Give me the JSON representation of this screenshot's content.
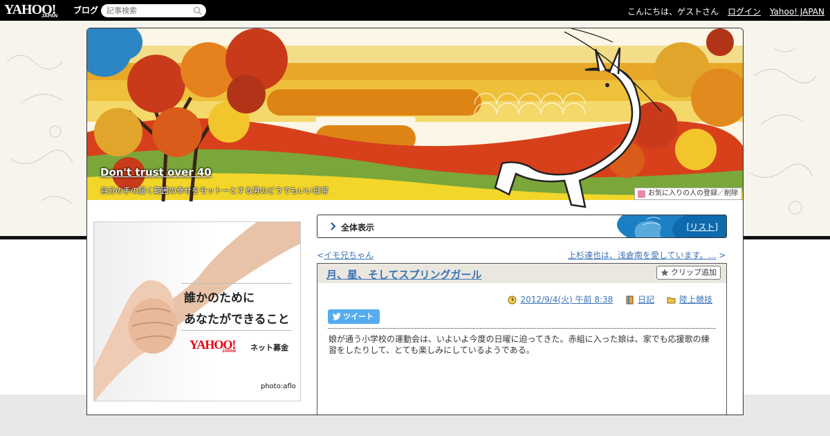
{
  "topbar": {
    "logo_text": "YAHOO!",
    "logo_sub": "JAPAN",
    "logo_service": "ブログ",
    "search_placeholder": "記事検索",
    "greeting": "こんにちは、ゲストさん",
    "login_label": "ログイン",
    "yahoo_japan_label": "Yahoo! JAPAN"
  },
  "header": {
    "blog_title": "Don't trust over 40",
    "blog_description": "自分の手の届く範囲の幸せをモットーとする男のどうでもいい日常",
    "favorite_button": "お気に入りの人の登録／削除"
  },
  "ad": {
    "line1": "誰かのために",
    "line2": "あなたができること",
    "logo_text": "YAHOO!",
    "logo_sub": "JAPAN",
    "service": "ネット募金",
    "credit": "photo:aflo"
  },
  "toolbar": {
    "all_view_label": "全体表示",
    "list_label": "リスト",
    "bracket_open": "[",
    "bracket_close": "]"
  },
  "navigation": {
    "prev_label": "イモ兄ちゃん",
    "prev_arrow": "<",
    "next_label": "上杉達也は、浅倉南を愛しています。…",
    "next_arrow": ">"
  },
  "article": {
    "title": "月、星、そしてスプリングガール",
    "clip_button": "クリップ追加",
    "date": "2012/9/4(火) 午前 8:38",
    "category_diary": "日記",
    "category_folder": "陸上競技",
    "tweet_label": "ツイート",
    "body": "娘が通う小学校の運動会は、いよいよ今度の日曜に迫ってきた。赤組に入った娘は、家でも応援歌の練習をしたりして、とても楽しみにしているようである。"
  },
  "colors": {
    "link": "#3a72b8",
    "tweet": "#55acee",
    "header_orange": "#e0861a",
    "header_red": "#d8401c",
    "header_green": "#7aa63a",
    "toolbar_blue": "#1b7fc4"
  }
}
